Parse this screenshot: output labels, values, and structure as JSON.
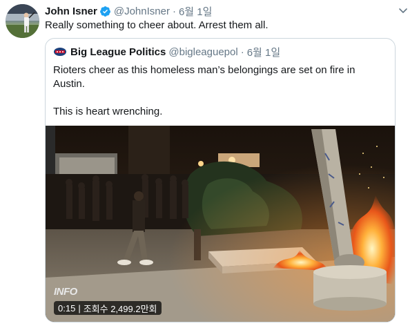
{
  "tweet": {
    "author_name": "John Isner",
    "author_handle": "@JohnIsner",
    "separator": "·",
    "date": "6월 1일",
    "text": "Really something to cheer about. Arrest them all."
  },
  "quoted_tweet": {
    "author_name": "Big League Politics",
    "author_handle": "@bigleaguepol",
    "separator": "·",
    "date": "6월 1일",
    "text_line1": "Rioters cheer as this homeless man’s belongings are set on fire in Austin.",
    "text_line2": "This is heart wrenching.",
    "video": {
      "watermark": "INFO",
      "elapsed": "0:15",
      "separator": "|",
      "views": "조회수 2,499.2만회"
    }
  },
  "icons": [
    "verified-badge-icon",
    "chevron-down-icon",
    "big-league-politics-logo"
  ],
  "colors": {
    "verified": "#1da1f2",
    "secondary_text": "#657786",
    "border": "#ccd6dd"
  }
}
